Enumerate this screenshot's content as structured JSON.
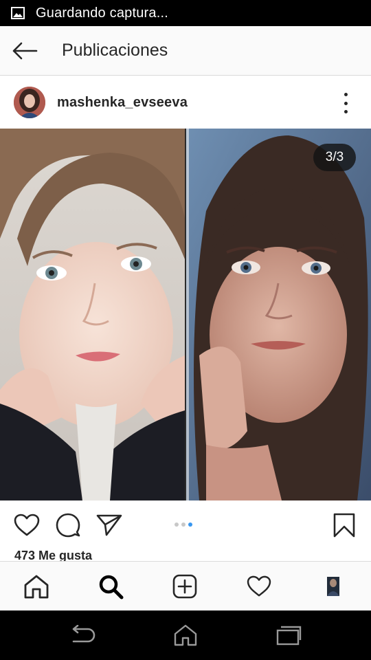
{
  "status_bar": {
    "icon": "image-icon",
    "text": "Guardando captura..."
  },
  "header": {
    "back_icon": "arrow-left-icon",
    "title": "Publicaciones"
  },
  "post": {
    "username": "mashenka_evseeva",
    "menu_icon": "more-vertical-icon",
    "photo_counter": "3/3",
    "carousel_total": 3,
    "carousel_active": 3,
    "likes": "473 Me gusta"
  },
  "actions": [
    "heart-icon",
    "comment-icon",
    "share-icon",
    "bookmark-icon"
  ],
  "bottom_nav": [
    "home-icon",
    "search-icon",
    "add-icon",
    "activity-heart-icon",
    "profile-avatar"
  ],
  "system_nav": [
    "back-icon",
    "home-icon",
    "recents-icon"
  ],
  "colors": {
    "accent": "#3897f0",
    "text": "#262626",
    "divider": "#dbdbdb"
  }
}
